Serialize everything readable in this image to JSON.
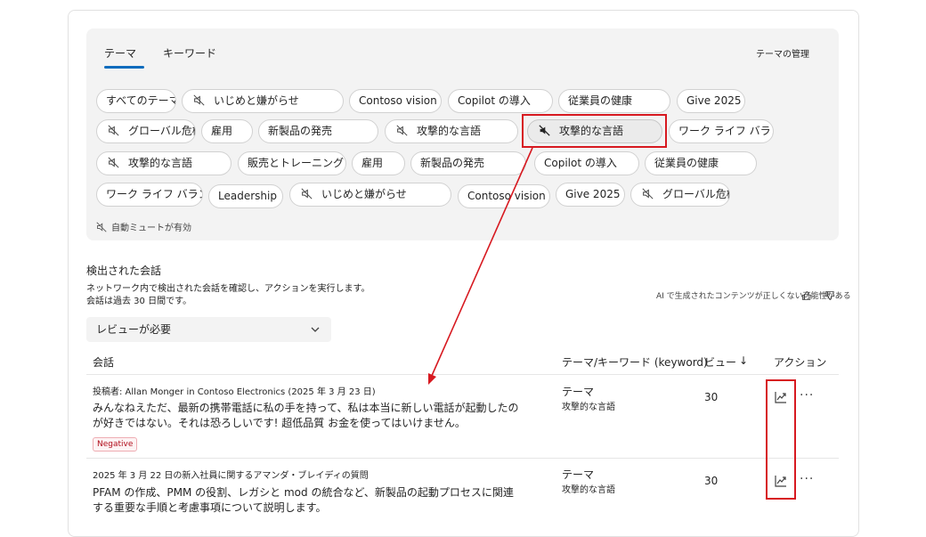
{
  "tabs": [
    {
      "label": "テーマ"
    },
    {
      "label": "キーワード"
    }
  ],
  "manage_link": "テーマの管理",
  "topics": [
    {
      "label": "すべてのテーマ",
      "muted": false
    },
    {
      "label": "いじめと嫌がらせ",
      "muted": true
    },
    {
      "label": "Contoso vision",
      "muted": false
    },
    {
      "label": "Copilot の導入",
      "muted": false
    },
    {
      "label": "従業員の健康",
      "muted": false
    },
    {
      "label": "Give 2025",
      "muted": false
    },
    {
      "label": "グローバル危機",
      "muted": true
    },
    {
      "label": "雇用",
      "muted": false
    },
    {
      "label": "新製品の発売",
      "muted": false
    },
    {
      "label": "攻撃的な言語",
      "muted": true
    },
    {
      "label": "攻撃的な言語",
      "muted": true,
      "selected": true
    },
    {
      "label": "ワーク ライフ バランス",
      "muted": false
    },
    {
      "label": "攻撃的な言語",
      "muted": true
    },
    {
      "label": "販売とトレーニング",
      "muted": false
    },
    {
      "label": "雇用",
      "muted": false
    },
    {
      "label": "新製品の発売",
      "muted": false
    },
    {
      "label": "Copilot の導入",
      "muted": false
    },
    {
      "label": "従業員の健康",
      "muted": false
    },
    {
      "label": "ワーク ライフ バランス",
      "muted": false
    },
    {
      "label": "Leadership",
      "muted": false
    },
    {
      "label": "いじめと嫌がらせ",
      "muted": true
    },
    {
      "label": "Contoso vision",
      "muted": false
    },
    {
      "label": "Give 2025",
      "muted": false
    },
    {
      "label": "グローバル危機",
      "muted": true
    }
  ],
  "auto_mute_label": "自動ミュートが有効",
  "section_title": "検出された会話",
  "section_desc_1": "ネットワーク内で検出された会話を確認し、アクションを実行します。",
  "section_desc_2": "会話は過去 30 日間です。",
  "ai_note": "AI で生成されたコンテンツが正しくない可能性がある",
  "filter_dropdown": "レビューが必要",
  "columns": {
    "conversation": "会話",
    "theme_keyword": "テーマ/キーワード (keyword)",
    "views": "ビュー",
    "sort_arrow": "↓",
    "actions": "アクション"
  },
  "rows": [
    {
      "meta": "投稿者: Allan Monger in Contoso Electronics (2025 年 3 月 23 日)",
      "body": "みんなねえただ、最新の携帯電話に私の手を持って、私は本当に新しい電話が起動したのが好きではない。それは恐ろしいです! 超低品質 お金を使ってはいけません。",
      "badge": "Negative",
      "theme_label": "テーマ",
      "theme_value": "攻撃的な言語",
      "views": "30"
    },
    {
      "meta": "2025 年 3 月 22 日の新入社員に関するアマンダ・ブレイディの質問",
      "body": "PFAM の作成、PMM の役割、レガシと mod の統合など、新製品の起動プロセスに関連する重要な手順と考慮事項について説明します。",
      "theme_label": "テーマ",
      "theme_value": "攻撃的な言語",
      "views": "30"
    }
  ],
  "more_label": "···",
  "colors": {
    "accent": "#0f6cbd",
    "annotation": "#d71920",
    "negative": "#b10e1c",
    "panel": "#f3f3f3"
  }
}
